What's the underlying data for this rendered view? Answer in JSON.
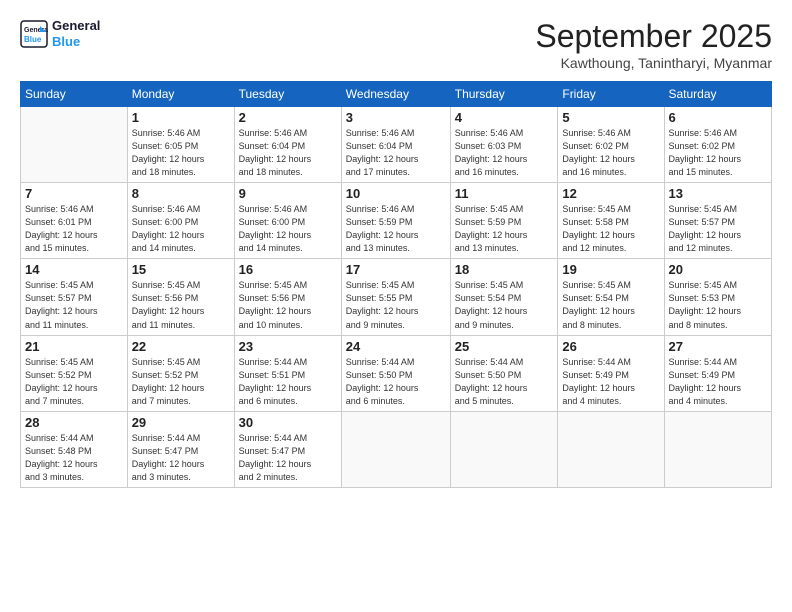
{
  "header": {
    "logo_line1": "General",
    "logo_line2": "Blue",
    "month_title": "September 2025",
    "location": "Kawthoung, Tanintharyi, Myanmar"
  },
  "days_of_week": [
    "Sunday",
    "Monday",
    "Tuesday",
    "Wednesday",
    "Thursday",
    "Friday",
    "Saturday"
  ],
  "weeks": [
    [
      {
        "day": "",
        "info": ""
      },
      {
        "day": "1",
        "info": "Sunrise: 5:46 AM\nSunset: 6:05 PM\nDaylight: 12 hours\nand 18 minutes."
      },
      {
        "day": "2",
        "info": "Sunrise: 5:46 AM\nSunset: 6:04 PM\nDaylight: 12 hours\nand 18 minutes."
      },
      {
        "day": "3",
        "info": "Sunrise: 5:46 AM\nSunset: 6:04 PM\nDaylight: 12 hours\nand 17 minutes."
      },
      {
        "day": "4",
        "info": "Sunrise: 5:46 AM\nSunset: 6:03 PM\nDaylight: 12 hours\nand 16 minutes."
      },
      {
        "day": "5",
        "info": "Sunrise: 5:46 AM\nSunset: 6:02 PM\nDaylight: 12 hours\nand 16 minutes."
      },
      {
        "day": "6",
        "info": "Sunrise: 5:46 AM\nSunset: 6:02 PM\nDaylight: 12 hours\nand 15 minutes."
      }
    ],
    [
      {
        "day": "7",
        "info": "Sunrise: 5:46 AM\nSunset: 6:01 PM\nDaylight: 12 hours\nand 15 minutes."
      },
      {
        "day": "8",
        "info": "Sunrise: 5:46 AM\nSunset: 6:00 PM\nDaylight: 12 hours\nand 14 minutes."
      },
      {
        "day": "9",
        "info": "Sunrise: 5:46 AM\nSunset: 6:00 PM\nDaylight: 12 hours\nand 14 minutes."
      },
      {
        "day": "10",
        "info": "Sunrise: 5:46 AM\nSunset: 5:59 PM\nDaylight: 12 hours\nand 13 minutes."
      },
      {
        "day": "11",
        "info": "Sunrise: 5:45 AM\nSunset: 5:59 PM\nDaylight: 12 hours\nand 13 minutes."
      },
      {
        "day": "12",
        "info": "Sunrise: 5:45 AM\nSunset: 5:58 PM\nDaylight: 12 hours\nand 12 minutes."
      },
      {
        "day": "13",
        "info": "Sunrise: 5:45 AM\nSunset: 5:57 PM\nDaylight: 12 hours\nand 12 minutes."
      }
    ],
    [
      {
        "day": "14",
        "info": "Sunrise: 5:45 AM\nSunset: 5:57 PM\nDaylight: 12 hours\nand 11 minutes."
      },
      {
        "day": "15",
        "info": "Sunrise: 5:45 AM\nSunset: 5:56 PM\nDaylight: 12 hours\nand 11 minutes."
      },
      {
        "day": "16",
        "info": "Sunrise: 5:45 AM\nSunset: 5:56 PM\nDaylight: 12 hours\nand 10 minutes."
      },
      {
        "day": "17",
        "info": "Sunrise: 5:45 AM\nSunset: 5:55 PM\nDaylight: 12 hours\nand 9 minutes."
      },
      {
        "day": "18",
        "info": "Sunrise: 5:45 AM\nSunset: 5:54 PM\nDaylight: 12 hours\nand 9 minutes."
      },
      {
        "day": "19",
        "info": "Sunrise: 5:45 AM\nSunset: 5:54 PM\nDaylight: 12 hours\nand 8 minutes."
      },
      {
        "day": "20",
        "info": "Sunrise: 5:45 AM\nSunset: 5:53 PM\nDaylight: 12 hours\nand 8 minutes."
      }
    ],
    [
      {
        "day": "21",
        "info": "Sunrise: 5:45 AM\nSunset: 5:52 PM\nDaylight: 12 hours\nand 7 minutes."
      },
      {
        "day": "22",
        "info": "Sunrise: 5:45 AM\nSunset: 5:52 PM\nDaylight: 12 hours\nand 7 minutes."
      },
      {
        "day": "23",
        "info": "Sunrise: 5:44 AM\nSunset: 5:51 PM\nDaylight: 12 hours\nand 6 minutes."
      },
      {
        "day": "24",
        "info": "Sunrise: 5:44 AM\nSunset: 5:50 PM\nDaylight: 12 hours\nand 6 minutes."
      },
      {
        "day": "25",
        "info": "Sunrise: 5:44 AM\nSunset: 5:50 PM\nDaylight: 12 hours\nand 5 minutes."
      },
      {
        "day": "26",
        "info": "Sunrise: 5:44 AM\nSunset: 5:49 PM\nDaylight: 12 hours\nand 4 minutes."
      },
      {
        "day": "27",
        "info": "Sunrise: 5:44 AM\nSunset: 5:49 PM\nDaylight: 12 hours\nand 4 minutes."
      }
    ],
    [
      {
        "day": "28",
        "info": "Sunrise: 5:44 AM\nSunset: 5:48 PM\nDaylight: 12 hours\nand 3 minutes."
      },
      {
        "day": "29",
        "info": "Sunrise: 5:44 AM\nSunset: 5:47 PM\nDaylight: 12 hours\nand 3 minutes."
      },
      {
        "day": "30",
        "info": "Sunrise: 5:44 AM\nSunset: 5:47 PM\nDaylight: 12 hours\nand 2 minutes."
      },
      {
        "day": "",
        "info": ""
      },
      {
        "day": "",
        "info": ""
      },
      {
        "day": "",
        "info": ""
      },
      {
        "day": "",
        "info": ""
      }
    ]
  ]
}
